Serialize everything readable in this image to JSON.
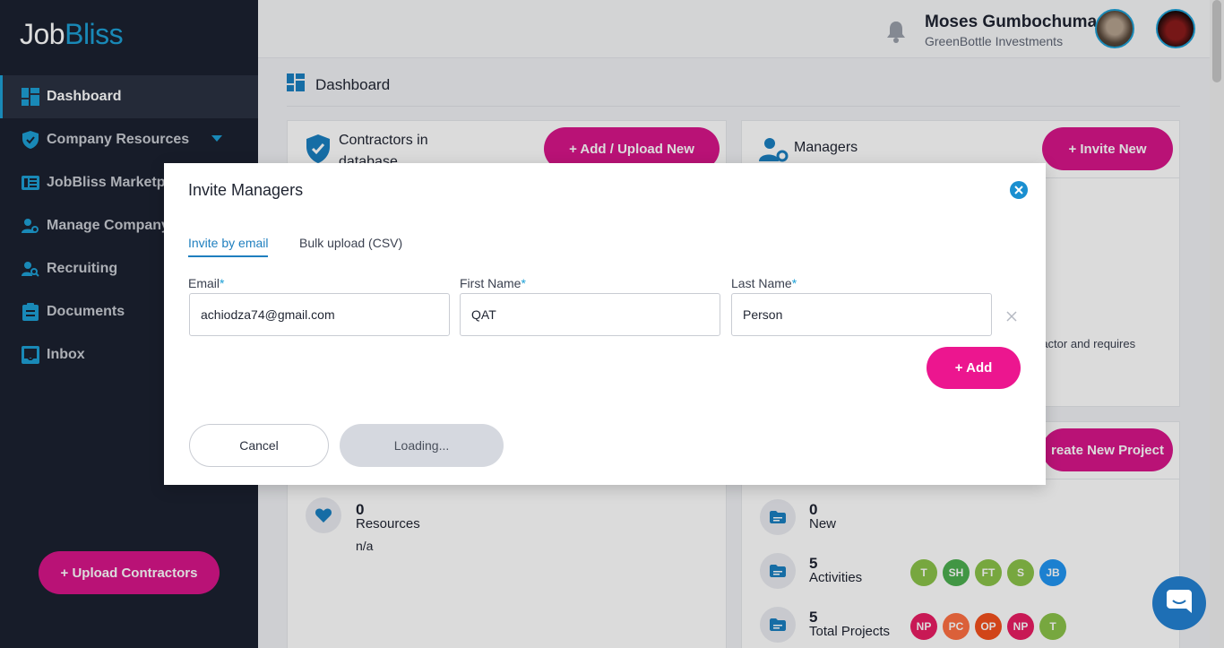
{
  "app": {
    "logo_prefix": "Job",
    "logo_suffix": "Bliss"
  },
  "sidebar": {
    "items": [
      {
        "label": "Dashboard",
        "icon": "dashboard-icon"
      },
      {
        "label": "Company Resources",
        "icon": "shield-icon"
      },
      {
        "label": "JobBliss Marketplace",
        "icon": "marketplace-icon"
      },
      {
        "label": "Manage Company",
        "icon": "manage-users-icon"
      },
      {
        "label": "Recruiting",
        "icon": "recruit-search-icon"
      },
      {
        "label": "Documents",
        "icon": "clipboard-icon"
      },
      {
        "label": "Inbox",
        "icon": "inbox-icon"
      }
    ],
    "upload_button": "+ Upload Contractors"
  },
  "header": {
    "user_name": "Moses Gumbochuma",
    "company": "GreenBottle Investments"
  },
  "breadcrumb": {
    "title": "Dashboard"
  },
  "cards": {
    "contractors": {
      "title_line1": "Contractors in",
      "title_line2": "database",
      "button": "+ Add / Upload New"
    },
    "managers": {
      "title": "Managers",
      "button": "+ Invite New",
      "snippet": "ractor and requires"
    },
    "projects": {
      "button": "reate New Project"
    },
    "resources": {
      "count": "0",
      "label": "Resources",
      "sub": "n/a"
    },
    "project_stats": [
      {
        "count": "0",
        "label": "New"
      },
      {
        "count": "5",
        "label": "Activities"
      },
      {
        "count": "5",
        "label": "Total Projects"
      }
    ],
    "activity_chips": [
      {
        "text": "T",
        "color": "#8bc34a"
      },
      {
        "text": "SH",
        "color": "#4caf50"
      },
      {
        "text": "FT",
        "color": "#8bc34a"
      },
      {
        "text": "S",
        "color": "#8bc34a"
      },
      {
        "text": "JB",
        "color": "#2196f3"
      }
    ],
    "project_chips": [
      {
        "text": "NP",
        "color": "#e91e63"
      },
      {
        "text": "PC",
        "color": "#ff7043"
      },
      {
        "text": "OP",
        "color": "#f4511e"
      },
      {
        "text": "NP",
        "color": "#e91e63"
      },
      {
        "text": "T",
        "color": "#8bc34a"
      }
    ]
  },
  "modal": {
    "title": "Invite Managers",
    "tabs": [
      "Invite by email",
      "Bulk upload (CSV)"
    ],
    "fields": [
      {
        "label": "Email",
        "value": "achiodza74@gmail.com"
      },
      {
        "label": "First Name",
        "value": "QAT"
      },
      {
        "label": "Last Name",
        "value": "Person"
      }
    ],
    "required_mark": "*",
    "add_button": "+ Add",
    "cancel_button": "Cancel",
    "submit_button": "Loading..."
  },
  "colors": {
    "brand_pink": "#d8168a",
    "accent_blue": "#1ea0d6",
    "sidebar_bg": "#1b2130"
  }
}
